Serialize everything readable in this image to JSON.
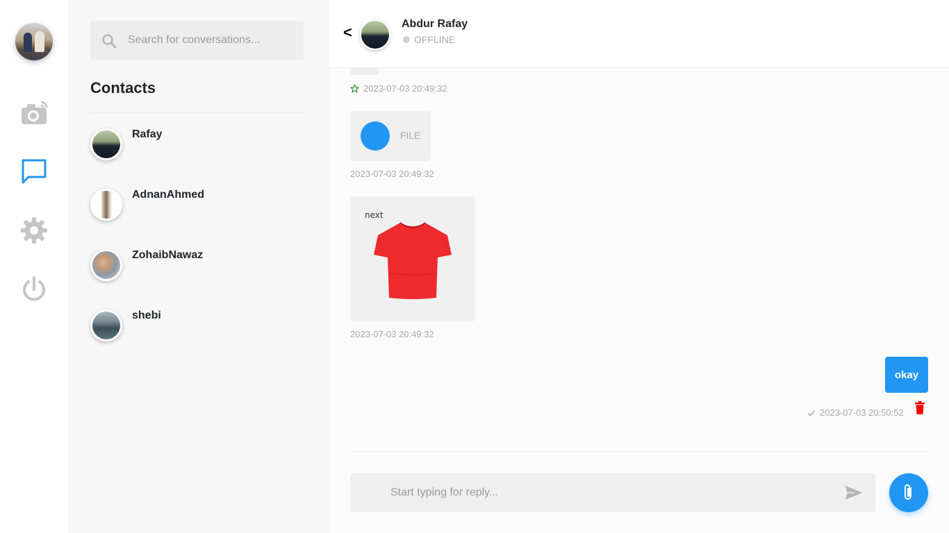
{
  "rail": {
    "profile_avatar": "user-avatar",
    "items": [
      {
        "icon": "camera-icon",
        "active": false
      },
      {
        "icon": "chat-bubble-icon",
        "active": true
      },
      {
        "icon": "gear-icon",
        "active": false
      },
      {
        "icon": "power-icon",
        "active": false
      }
    ],
    "active_color": "#2196f3",
    "inactive_color": "#c5c5c8"
  },
  "search": {
    "placeholder": "Search for conversations..."
  },
  "contacts": {
    "title": "Contacts",
    "items": [
      {
        "name": "Rafay"
      },
      {
        "name": "AdnanAhmed"
      },
      {
        "name": "ZohaibNawaz"
      },
      {
        "name": "shebi"
      }
    ]
  },
  "chat": {
    "back_label": "<",
    "contact_name": "Abdur Rafay",
    "status": "OFFLINE",
    "messages": [
      {
        "type": "text-stub",
        "time": "2023-07-03 20:49:32",
        "starred": true
      },
      {
        "type": "file",
        "label": "FILE",
        "time": "2023-07-03 20:49:32"
      },
      {
        "type": "image",
        "brand": "next",
        "time": "2023-07-03 20:49:32"
      },
      {
        "type": "sent",
        "text": "okay",
        "time": "2023-07-03 20:50:52",
        "delivered": true
      }
    ],
    "reply_placeholder": "Start typing for reply...",
    "accent_color": "#2196f3",
    "delete_color": "#ff0000"
  }
}
